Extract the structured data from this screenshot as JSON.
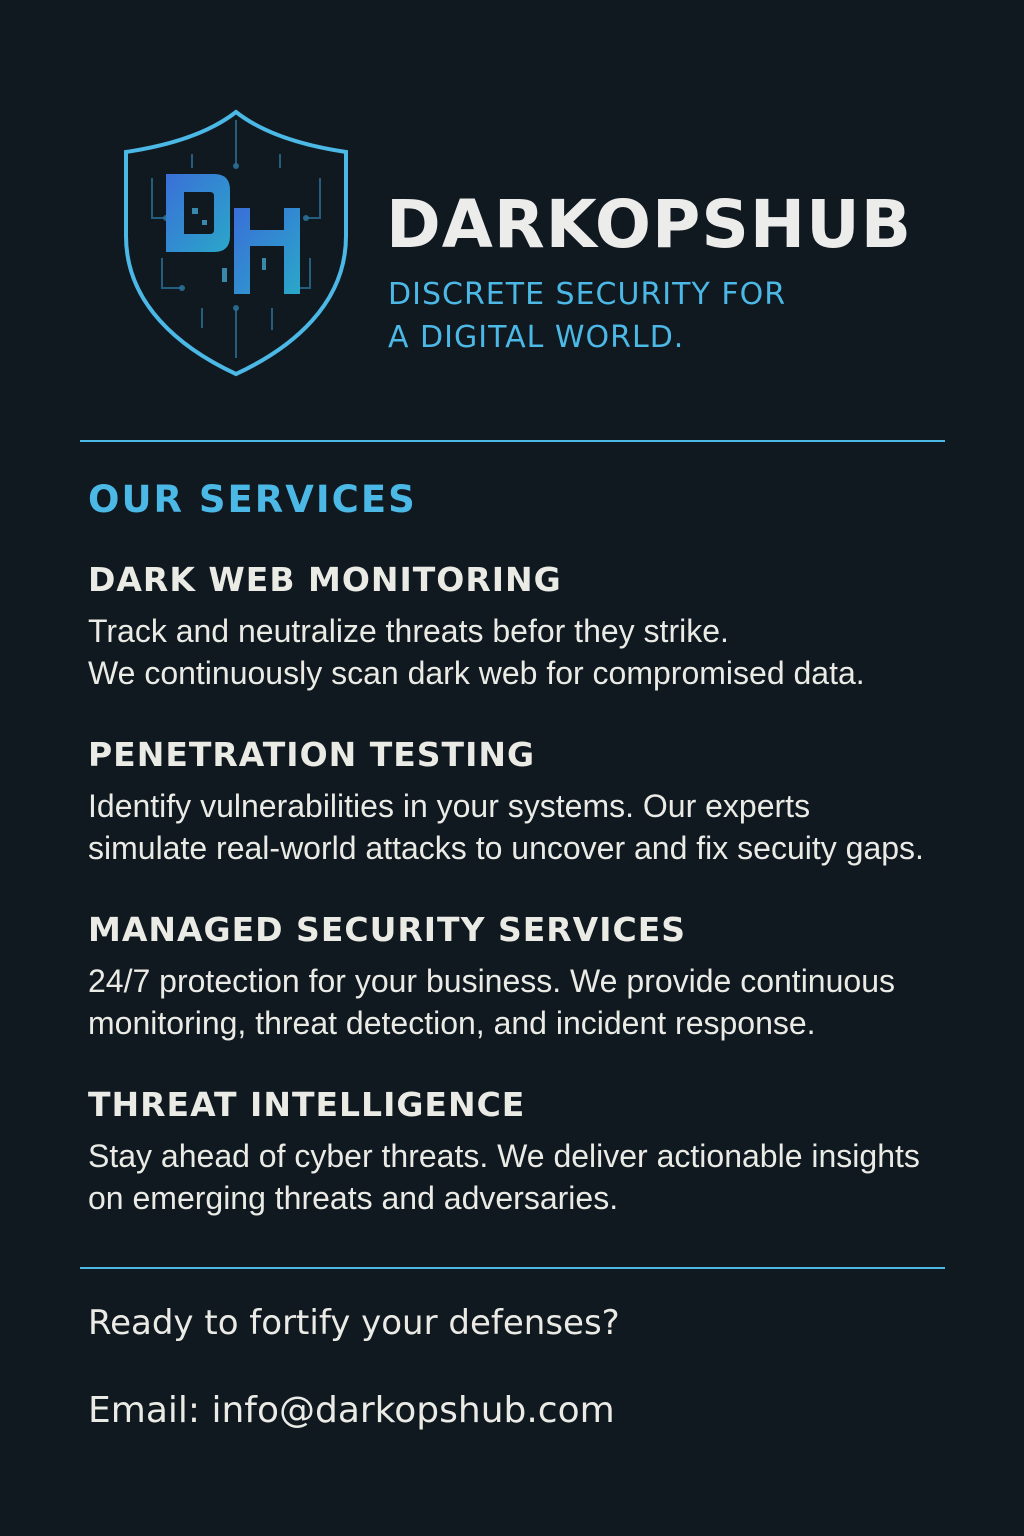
{
  "brand": {
    "name": "DARKOPSHUB",
    "tagline_line1": "DISCRETE SECURITY FOR",
    "tagline_line2": "A DIGITAL WORLD.",
    "logo_icon": "shield-icon",
    "logo_monogram": "DH"
  },
  "colors": {
    "background": "#101820",
    "accent": "#4bb8e6",
    "text": "#ebebe6",
    "logo_gradient_start": "#3a6fd8",
    "logo_gradient_end": "#2aa7c9"
  },
  "services": {
    "heading": "OUR SERVICES",
    "items": [
      {
        "title": "DARK WEB MONITORING",
        "desc_line1": "Track and neutralize threats befor they strike.",
        "desc_line2": "We continuously scan dark web for compromised data."
      },
      {
        "title": "PENETRATION TESTING",
        "desc_line1": "Identify vulnerabilities in your systems. Our experts",
        "desc_line2": "simulate real-world attacks to uncover and fix secuity gaps."
      },
      {
        "title": "MANAGED SECURITY SERVICES",
        "desc_line1": "24/7 protection for your business. We provide continuous",
        "desc_line2": "monitoring, threat detection, and incident response."
      },
      {
        "title": "THREAT INTELLIGENCE",
        "desc_line1": "Stay ahead of cyber threats. We deliver actionable insights",
        "desc_line2": "on emerging threats and adversaries."
      }
    ]
  },
  "cta": {
    "text": "Ready to fortify your defenses?",
    "email_line": "Email: info@darkopshub.com"
  }
}
